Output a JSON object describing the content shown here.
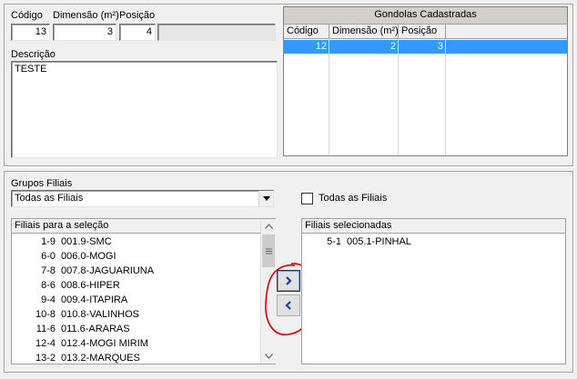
{
  "top": {
    "labels": {
      "codigo": "Código",
      "dimensao": "Dimensão (m²)",
      "posicao": "Posição",
      "descricao": "Descrição"
    },
    "fields": {
      "codigo": "13",
      "dimensao": "3",
      "posicao": "4",
      "descricao": "TESTE"
    }
  },
  "grid": {
    "title": "Gondolas Cadastradas",
    "columns": [
      "Código",
      "Dimensão (m²)",
      "Posição"
    ],
    "rows": [
      {
        "codigo": "12",
        "dimensao": "2",
        "posicao": "3",
        "selected": true
      }
    ],
    "selected_color": "#3399ff"
  },
  "bottom": {
    "grupos_label": "Grupos Filiais",
    "grupos_value": "Todas as Filiais",
    "todas_checkbox_label": "Todas as Filiais",
    "todas_checked": false,
    "available": {
      "header": "Filiais para a seleção",
      "items": [
        {
          "code": "1-9",
          "name": "001.9-SMC"
        },
        {
          "code": "6-0",
          "name": "006.0-MOGI"
        },
        {
          "code": "7-8",
          "name": "007.8-JAGUARIUNA"
        },
        {
          "code": "8-6",
          "name": "008.6-HIPER"
        },
        {
          "code": "9-4",
          "name": "009.4-ITAPIRA"
        },
        {
          "code": "10-8",
          "name": "010.8-VALINHOS"
        },
        {
          "code": "11-6",
          "name": "011.6-ARARAS"
        },
        {
          "code": "12-4",
          "name": "012.4-MOGI MIRIM"
        },
        {
          "code": "13-2",
          "name": "013.2-MARQUES"
        }
      ]
    },
    "selected": {
      "header": "Filiais selecionadas",
      "items": [
        {
          "code": "5-1",
          "name": "005.1-PINHAL"
        }
      ]
    },
    "buttons": {
      "add_icon": "chevron-right-icon",
      "remove_icon": "chevron-left-icon"
    },
    "annotation_color": "#e00000"
  }
}
